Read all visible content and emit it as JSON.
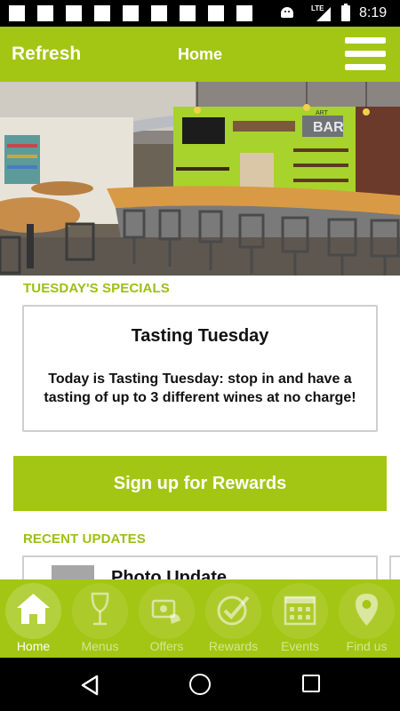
{
  "status_bar": {
    "network": "LTE",
    "time": "8:19"
  },
  "app_bar": {
    "refresh_label": "Refresh",
    "title": "Home",
    "menu_icon": "hamburger-menu-icon"
  },
  "hero_image": {
    "sign_text": "BAR",
    "sign_prefix": "ART"
  },
  "specials": {
    "section_title": "TUESDAY'S SPECIALS",
    "card_title": "Tasting Tuesday",
    "card_description": "Today is Tasting Tuesday: stop in and have a tasting of up to 3 different wines at no charge!"
  },
  "rewards_button": {
    "label": "Sign up for Rewards"
  },
  "recent_updates": {
    "section_title": "RECENT UPDATES",
    "items": [
      {
        "title": "Photo Update"
      }
    ]
  },
  "tabs": [
    {
      "label": "Home",
      "icon": "home-icon",
      "active": true
    },
    {
      "label": "Menus",
      "icon": "wine-glass-icon",
      "active": false
    },
    {
      "label": "Offers",
      "icon": "offers-icon",
      "active": false
    },
    {
      "label": "Rewards",
      "icon": "checkmark-icon",
      "active": false
    },
    {
      "label": "Events",
      "icon": "calendar-icon",
      "active": false
    },
    {
      "label": "Find us",
      "icon": "map-pin-icon",
      "active": false
    }
  ],
  "colors": {
    "brand": "#a3c614",
    "section_title": "#9cc012",
    "card_border": "#cfcfcf"
  }
}
